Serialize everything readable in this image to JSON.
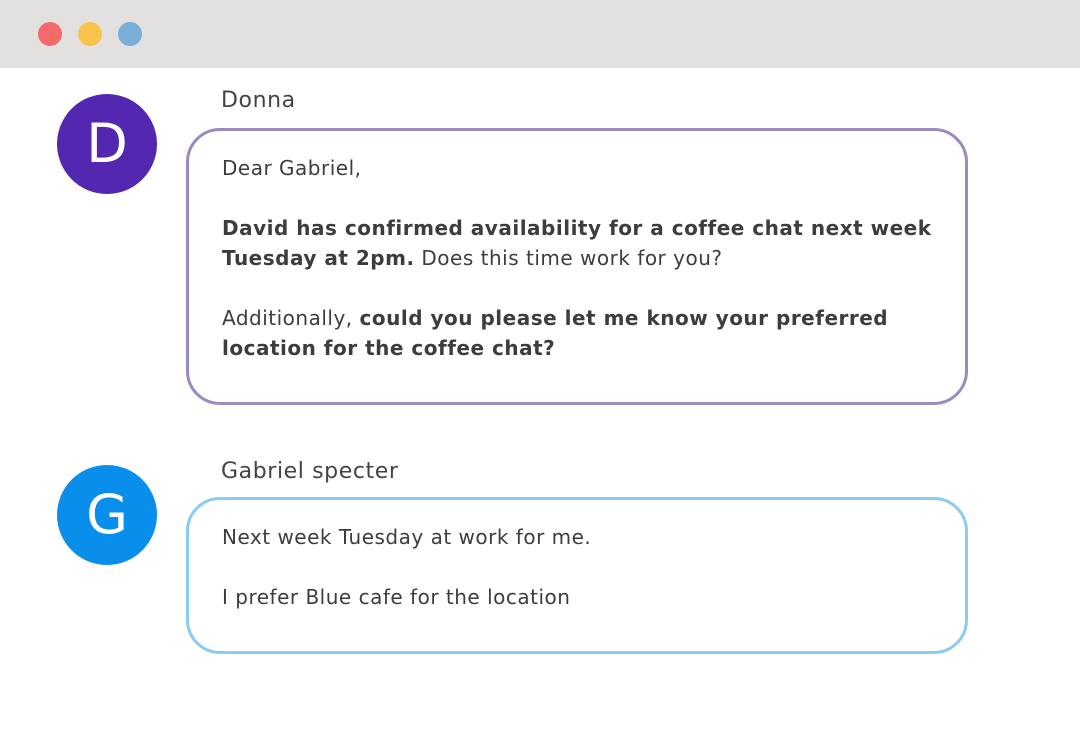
{
  "window": {
    "controls": [
      "close",
      "minimize",
      "maximize"
    ]
  },
  "messages": [
    {
      "avatar_letter": "D",
      "avatar_color": "#5327b0",
      "sender": "Donna",
      "bubble_border_color": "#9b8abf",
      "paragraphs": [
        {
          "normal": "Dear Gabriel,"
        },
        {
          "bold": "David has confirmed availability for a coffee chat next week Tuesday at 2pm.",
          "normal": " Does this time work for you?"
        },
        {
          "normal": "Additionally, ",
          "bold": "could you please let me know your preferred location for the coffee chat?"
        }
      ]
    },
    {
      "avatar_letter": "G",
      "avatar_color": "#0a8eeb",
      "sender": "Gabriel specter",
      "bubble_border_color": "#8ccaf2",
      "paragraphs": [
        {
          "normal": "Next week Tuesday at work for me."
        },
        {
          "normal": "I prefer Blue cafe for the location"
        }
      ]
    }
  ]
}
